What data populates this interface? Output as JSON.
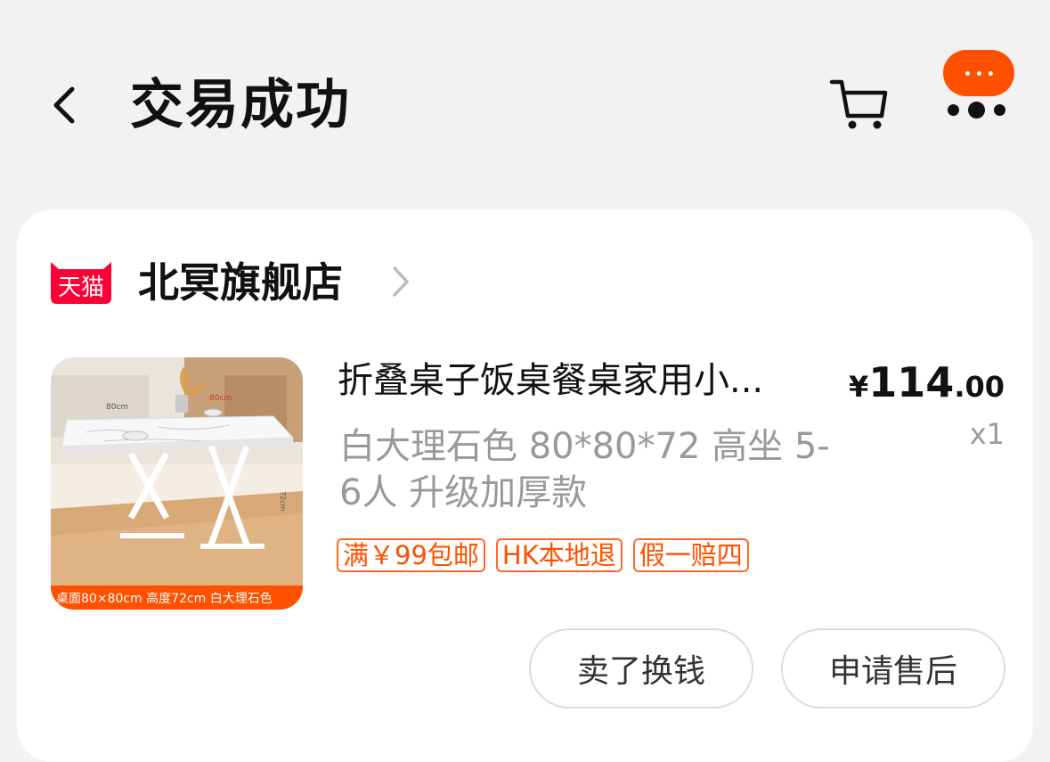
{
  "header": {
    "title": "交易成功",
    "back_icon": "chevron-left-icon",
    "cart_icon": "cart-icon",
    "more_icon": "more-dots-icon",
    "accent_color": "#ff5000"
  },
  "shop": {
    "badge_text": "天猫",
    "name": "北冥旗舰店",
    "badge_color": "#ff0036"
  },
  "product": {
    "name": "折叠桌子饭桌餐桌家用小...",
    "sku": "白大理石色 80*80*72 高坐 5-6人 升级加厚款",
    "price_symbol": "¥",
    "price_int": "114",
    "price_dec": ".00",
    "quantity": "x1",
    "image_caption": "桌面80×80cm 高度72cm 白大理石色",
    "image_dim_width": "80cm",
    "image_dim_depth": "80cm",
    "image_dim_height": "72cm",
    "tags": [
      "满￥99包邮",
      "HK本地退",
      "假一赔四"
    ]
  },
  "actions": {
    "sell_label": "卖了换钱",
    "after_sale_label": "申请售后"
  }
}
